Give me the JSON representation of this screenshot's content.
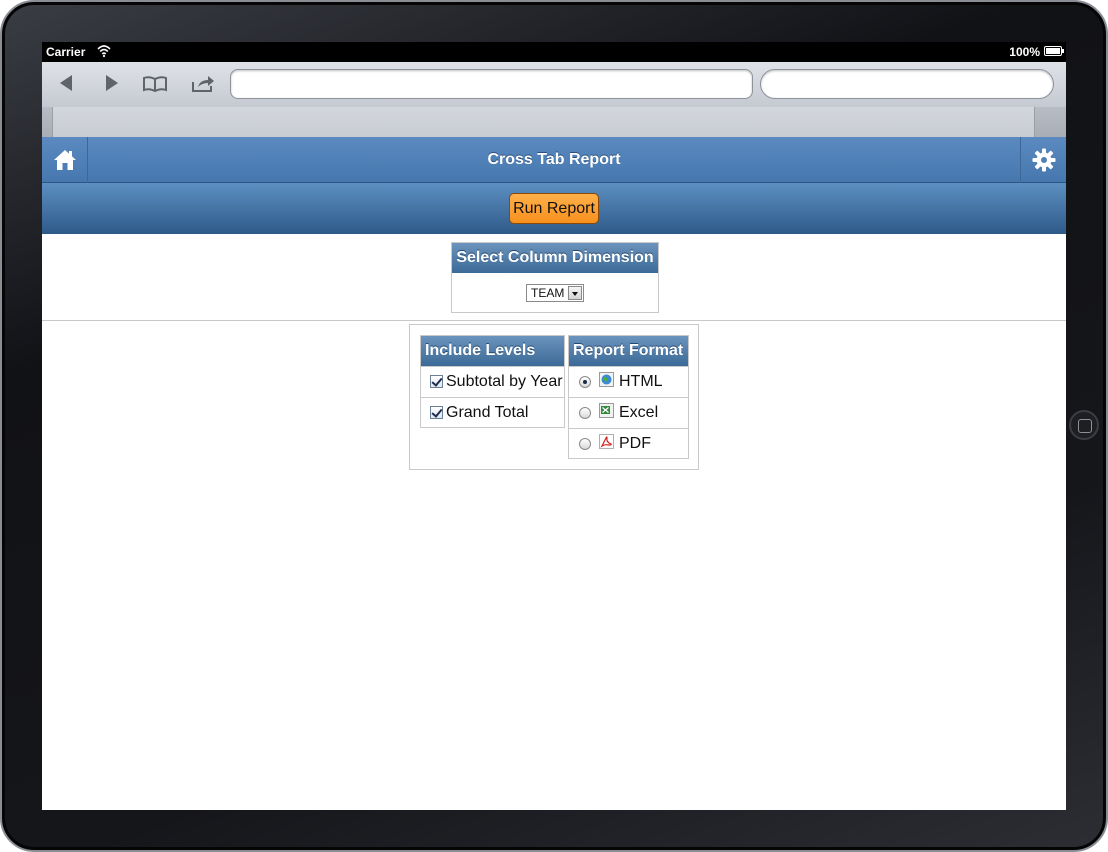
{
  "status_bar": {
    "carrier": "Carrier",
    "battery": "100%"
  },
  "app": {
    "title": "Cross Tab Report"
  },
  "toolbar": {
    "run_label": "Run Report"
  },
  "column_dimension": {
    "heading": "Select Column Dimension",
    "selected": "TEAM"
  },
  "include_levels": {
    "heading": "Include Levels",
    "items": [
      {
        "label": "Subtotal by Year",
        "checked": true
      },
      {
        "label": "Grand Total",
        "checked": true
      }
    ]
  },
  "report_format": {
    "heading": "Report Format",
    "options": [
      {
        "label": "HTML",
        "icon": "globe-icon",
        "selected": true
      },
      {
        "label": "Excel",
        "icon": "excel-icon",
        "selected": false
      },
      {
        "label": "PDF",
        "icon": "pdf-icon",
        "selected": false
      }
    ]
  },
  "colors": {
    "header_blue": "#4f80b8",
    "run_button_orange": "#f7901e",
    "panel_head_blue": "#3c6a97"
  }
}
